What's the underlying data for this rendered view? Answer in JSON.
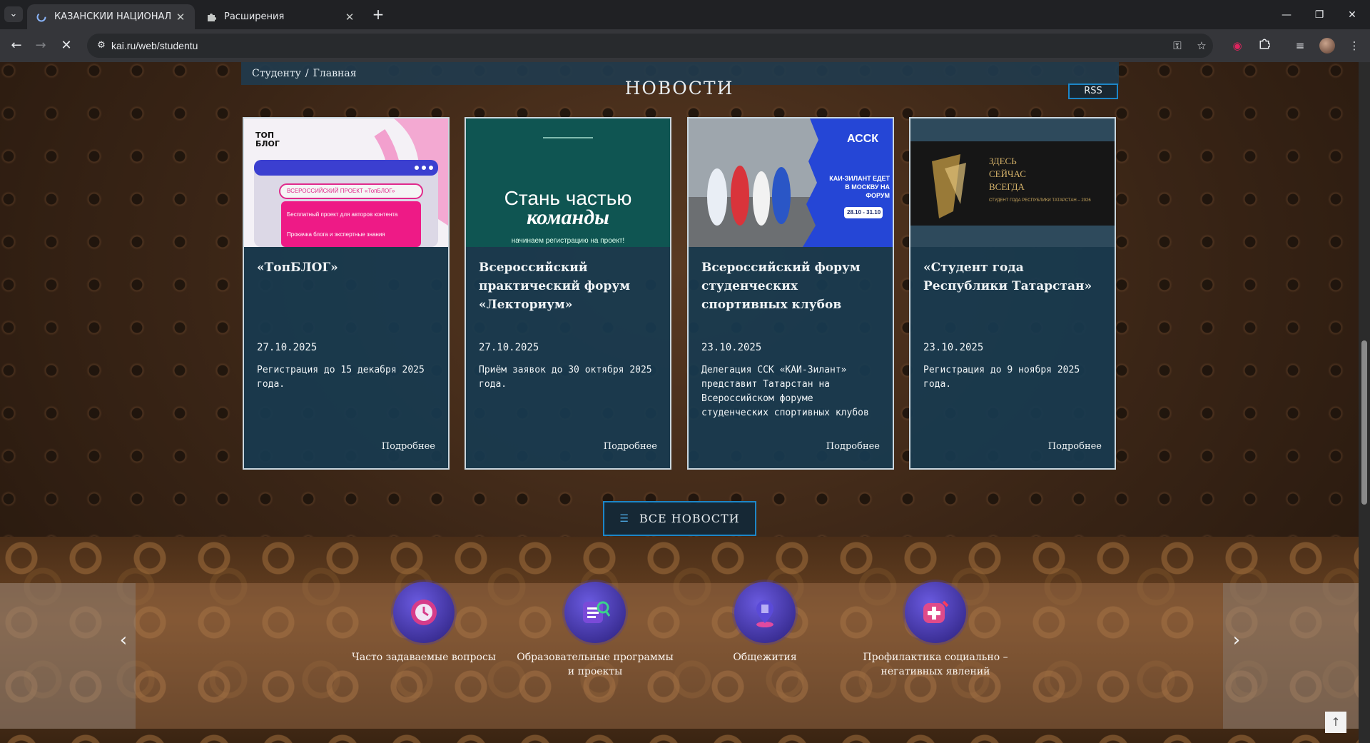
{
  "browser": {
    "tabs": [
      {
        "title": "КАЗАНСКИЙ НАЦИОНАЛЬНЫ",
        "icon": "loading-spinner-icon"
      },
      {
        "title": "Расширения",
        "icon": "puzzle-icon"
      }
    ],
    "url": "kai.ru/web/studentu"
  },
  "breadcrumb": {
    "root": "Студенту",
    "separator": "/",
    "current": "Главная"
  },
  "news": {
    "heading": "НОВОСТИ",
    "rss_label": "RSS",
    "more_label": "Подробнее",
    "items": [
      {
        "title": "«ТопБЛОГ»",
        "date": "27.10.2025",
        "description": "Регистрация до 15 декабря 2025 года.",
        "image": {
          "logo": "ТОП БЛОГ",
          "banner": "ВСЕРОССИЙСКИЙ ПРОЕКТ «ТопБЛОГ»",
          "line1": "Бесплатный проект для авторов контента",
          "line2": "Прокачка блога и экспертные знания"
        }
      },
      {
        "title": "Всероссийский практический форум «Лекториум»",
        "date": "27.10.2025",
        "description": "Приём заявок до 30 октября 2025 года.",
        "image": {
          "line1": "Стань частью",
          "line2": "команды",
          "line3": "начинаем регистрацию на проект!"
        }
      },
      {
        "title": "Всероссийский форум студенческих спортивных клубов",
        "date": "23.10.2025",
        "description": "Делегация ССК «КАИ-Зилант» представит Татарстан на Всероссийском форуме студенческих спортивных клубов",
        "image": {
          "brand": "АССК",
          "caption": "КАИ-ЗИЛАНТ ЕДЕТ В МОСКВУ НА ФОРУМ",
          "dates": "28.10 - 31.10"
        }
      },
      {
        "title": "«Студент года Республики Татарстан»",
        "date": "23.10.2025",
        "description": "Регистрация до 9 ноября 2025 года.",
        "image": {
          "line1": "ЗДЕСЬ",
          "line2": "СЕЙЧАС",
          "line3": "ВСЕГДА",
          "caption": "СТУДЕНТ ГОДА РЕСПУБЛИКИ ТАТАРСТАН – 2026"
        }
      }
    ],
    "all_news_label": "ВСЕ НОВОСТИ"
  },
  "quick_links": [
    {
      "label": "Часто задаваемые вопросы",
      "icon": "clock-icon",
      "color": "#d63c8a"
    },
    {
      "label": "Образовательные программы и проекты",
      "icon": "document-search-icon",
      "color": "#7a4ad8"
    },
    {
      "label": "Общежития",
      "icon": "building-pin-icon",
      "color": "#5a4ad8"
    },
    {
      "label": "Профилактика социально – негативных явлений",
      "icon": "medical-plus-icon",
      "color": "#e04a8a"
    }
  ],
  "colors": {
    "accent": "#1d86c7",
    "card_bg": "#183a50"
  }
}
